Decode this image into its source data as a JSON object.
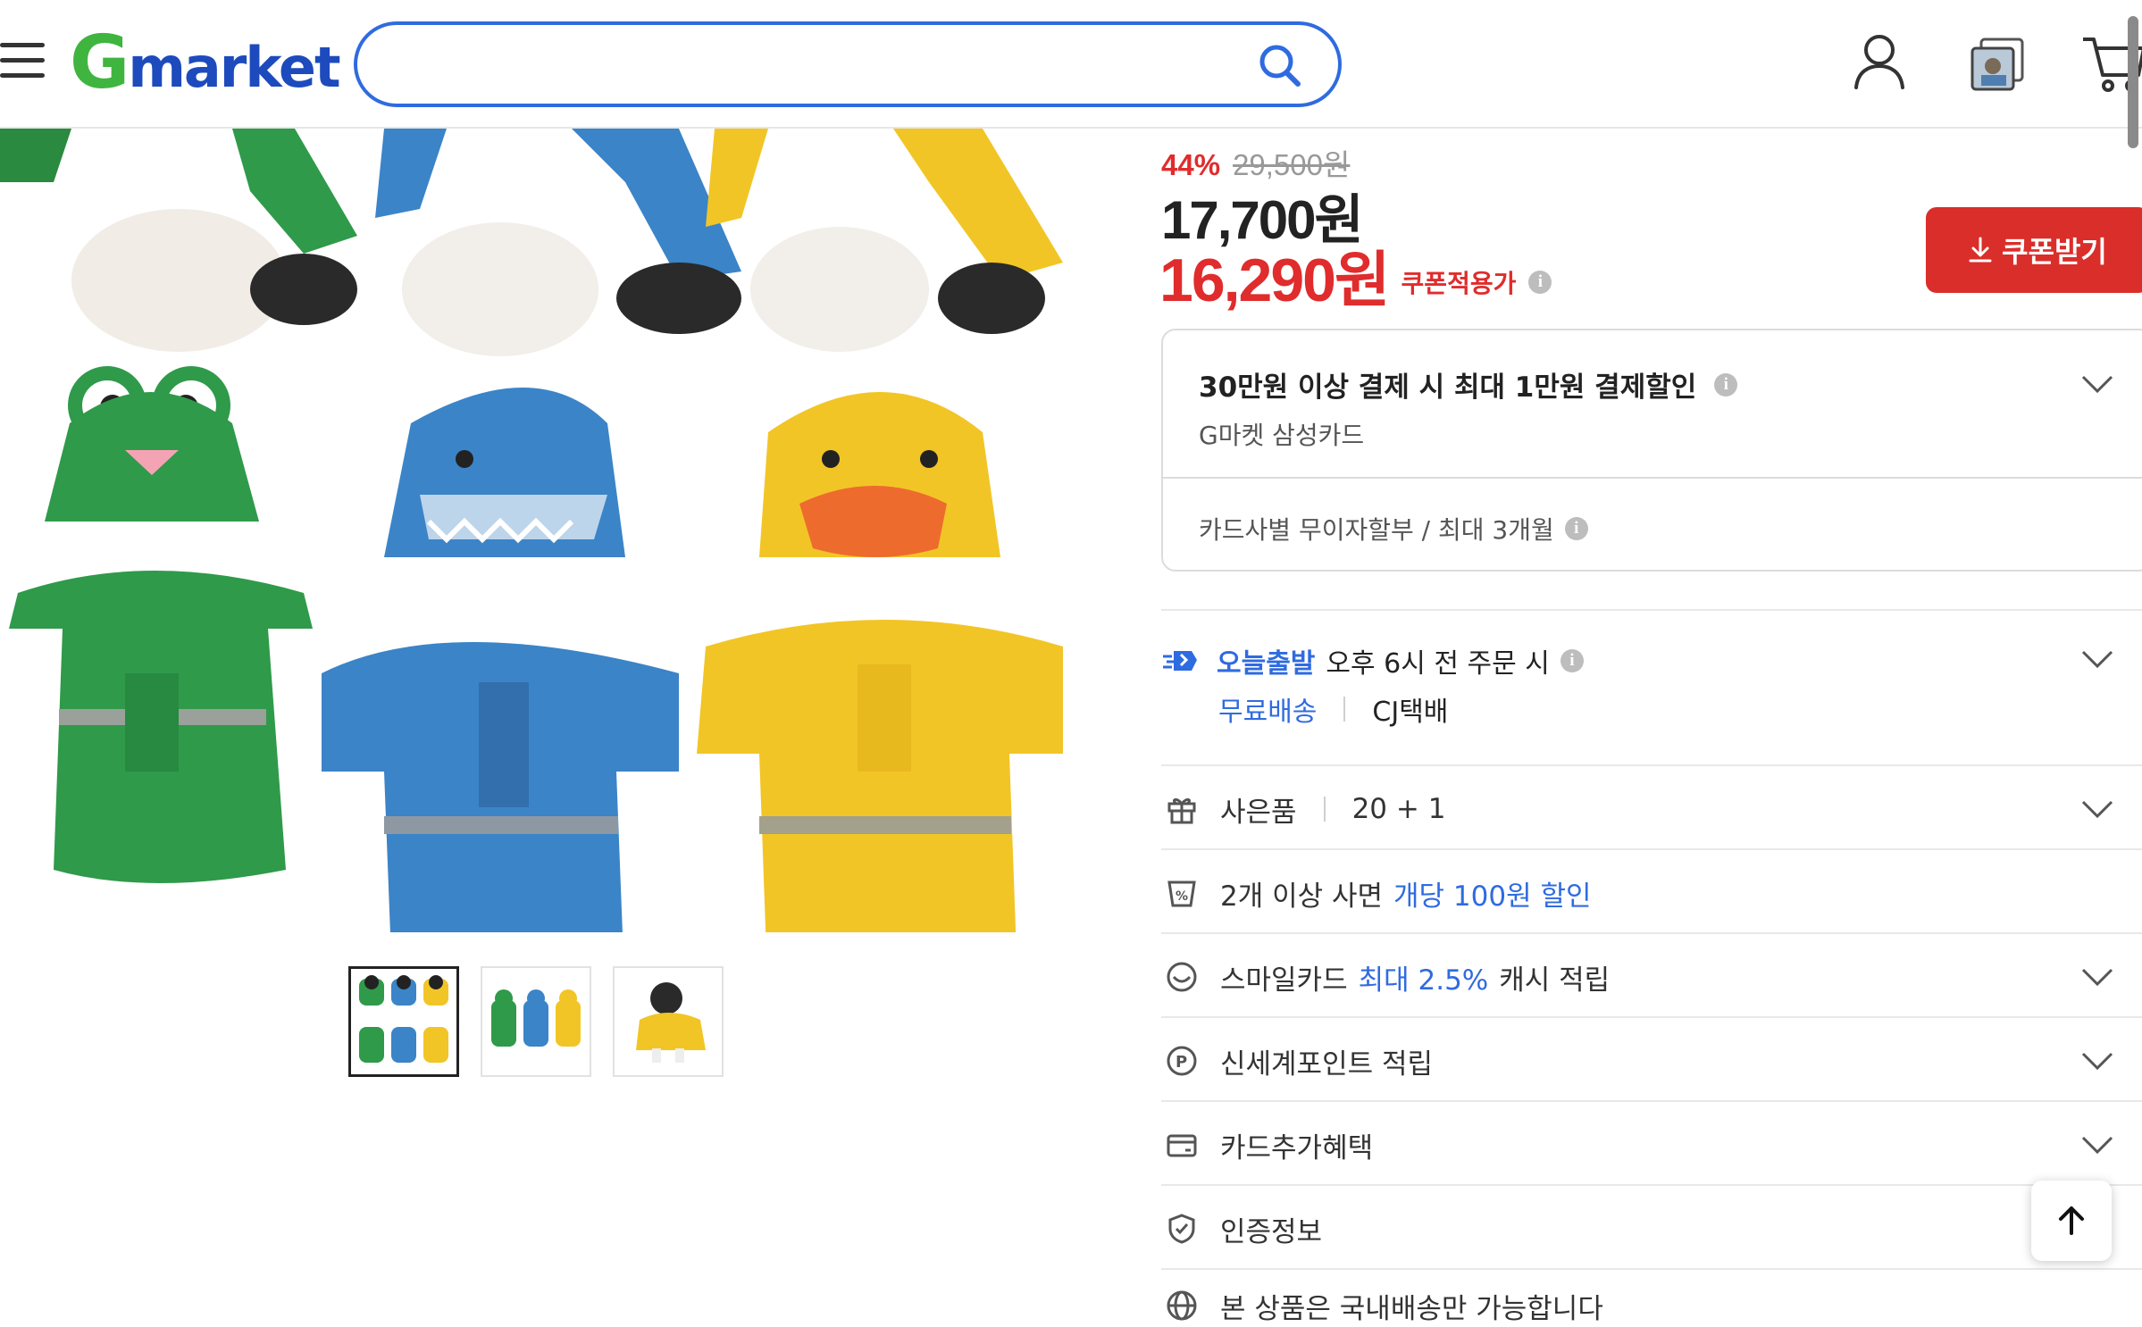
{
  "header": {
    "logo_g": "G",
    "logo_rest": "market",
    "search_value": ""
  },
  "price": {
    "discount_percent": "44%",
    "original_price": "29,500원",
    "sale_price": "17,700원",
    "coupon_price": "16,290원",
    "coupon_label": "쿠폰적용가",
    "coupon_button": "쿠폰받기",
    "info_glyph": "i"
  },
  "card_promo": {
    "title": "30만원 이상 결제 시 최대 1만원 결제할인",
    "card_name": "G마켓 삼성카드",
    "installment": "카드사별 무이자할부 / 최대 3개월"
  },
  "shipping": {
    "badge": "오늘출발",
    "cutoff": "오후 6시 전 주문 시",
    "free": "무료배송",
    "carrier": "CJ택배"
  },
  "benefits": {
    "gift_label": "사은품",
    "gift_value": "20 + 1",
    "multi_prefix": "2개 이상 사면",
    "multi_highlight": "개당 100원 할인",
    "smile_prefix": "스마일카드",
    "smile_highlight": "최대 2.5%",
    "smile_suffix": "캐시 적립",
    "point": "신세계포인트 적립",
    "card_extra": "카드추가혜택",
    "certification": "인증정보",
    "domestic_only": "본 상품은 국내배송만 가능합니다"
  },
  "gallery": {
    "thumb_count": 3,
    "selected_thumb": 1
  },
  "colors": {
    "brand_green": "#3fb53f",
    "brand_blue": "#1d4bbd",
    "accent_blue": "#2f6be0",
    "sale_red": "#e02c2c",
    "coupon_button": "#da2e2a"
  },
  "icons": [
    "menu-icon",
    "search-icon",
    "user-icon",
    "recent-items-icon",
    "cart-icon",
    "gift-icon",
    "discount-tag-icon",
    "smile-card-icon",
    "point-icon",
    "credit-card-icon",
    "shield-check-icon",
    "globe-icon",
    "truck-icon",
    "download-icon",
    "arrow-up-icon",
    "chevron-down-icon",
    "info-icon"
  ]
}
